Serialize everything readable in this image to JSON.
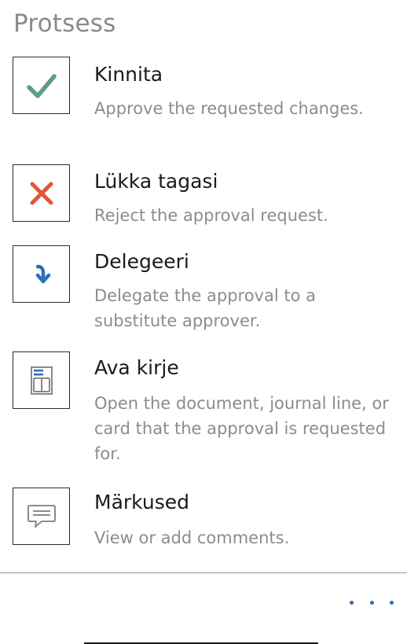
{
  "header": {
    "title": "Protsess"
  },
  "actions": [
    {
      "title": "Kinnita",
      "description": "Approve the requested changes.",
      "icon": "checkmark-icon",
      "color": "#5a9e84"
    },
    {
      "title": "Lükka tagasi",
      "description": "Reject the approval request.",
      "icon": "close-icon",
      "color": "#e0573a"
    },
    {
      "title": "Delegeeri",
      "description": "Delegate the approval to a substitute approver.",
      "icon": "delegate-arrow-icon",
      "color": "#2f6fb5"
    },
    {
      "title": "Ava kirje",
      "description": "Open the document, journal line, or card that the approval is requested for.",
      "icon": "document-icon",
      "color": "#8a8a8a"
    },
    {
      "title": "Märkused",
      "description": "View or add comments.",
      "icon": "comment-icon",
      "color": "#8a8a8a"
    }
  ],
  "footer": {
    "more_icon": "more-icon",
    "accent": "#2f6fb5"
  }
}
